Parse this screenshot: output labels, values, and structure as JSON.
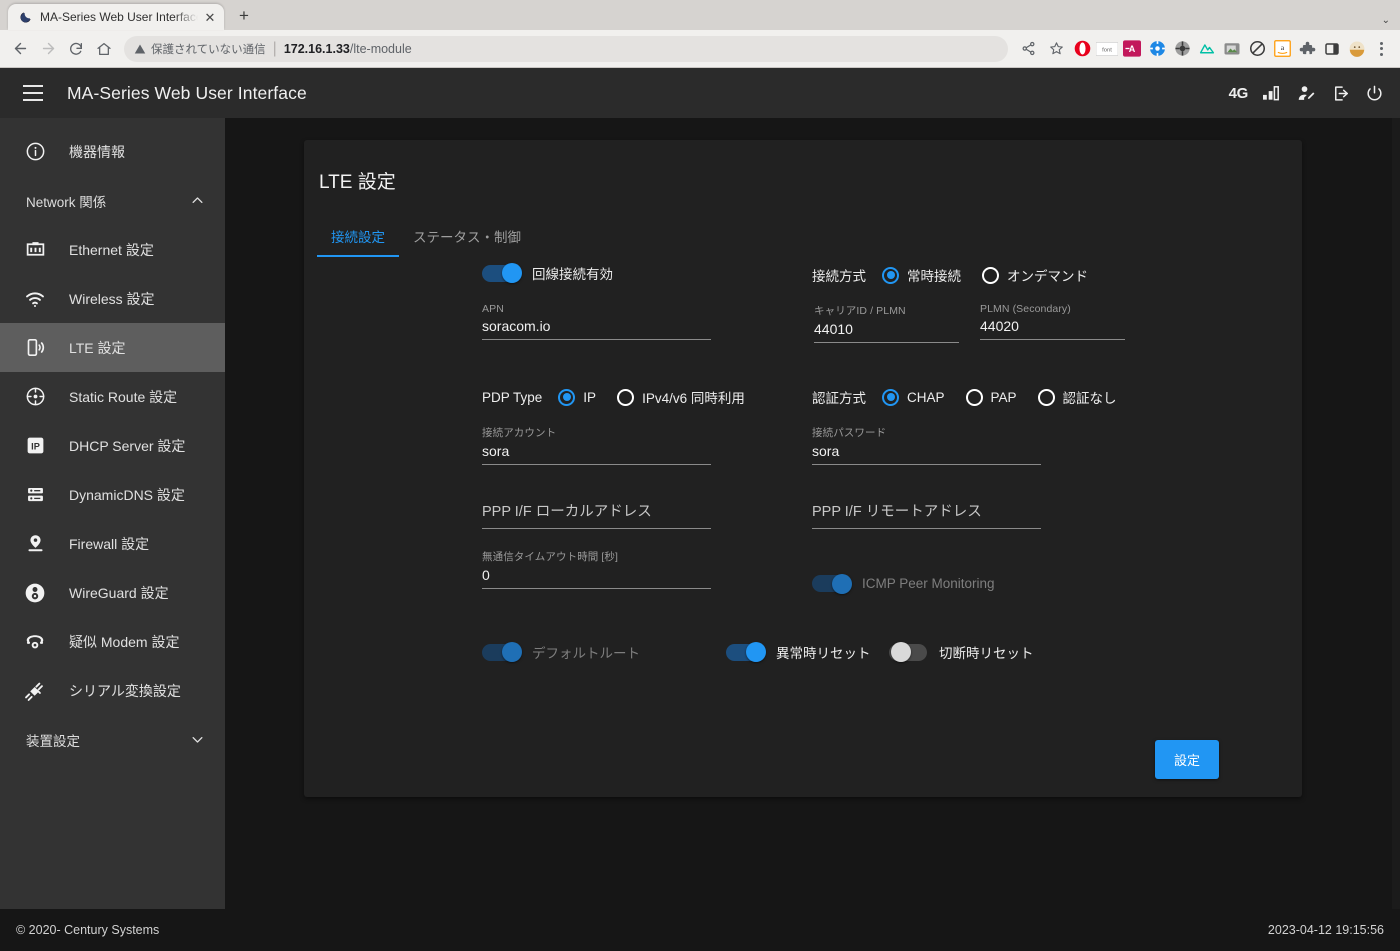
{
  "browser": {
    "tab": {
      "title": "MA-Series Web User Interface",
      "favicon": "moon-icon",
      "close_label": "✕"
    },
    "newtab_label": "+",
    "window_minimize_label": "⌄",
    "nav": {
      "back": "←",
      "forward": "→",
      "reload": "⟳",
      "home": "⌂"
    },
    "omnibox": {
      "security_warning": "保護されていない通信",
      "url_host": "172.16.1.33",
      "url_path": "/lte-module",
      "share_icon": "share-icon",
      "bookmark_icon": "star-icon"
    },
    "extensions": [
      {
        "name": "opera-icon",
        "glyph": "●",
        "color": "#e8001c"
      },
      {
        "name": "font-extension-icon",
        "glyph": "font",
        "color": "#5f6368"
      },
      {
        "name": "translate-extension-icon",
        "glyph": "⇥A",
        "color": "#c2185b"
      },
      {
        "name": "compass-extension-icon",
        "glyph": "✷",
        "color": "#1e88e5"
      },
      {
        "name": "shutter-extension-icon",
        "glyph": "✻",
        "color": "#9e9e9e"
      },
      {
        "name": "mountain-extension-icon",
        "glyph": "▲",
        "color": "#00bfa5"
      },
      {
        "name": "screenshot-extension-icon",
        "glyph": "▣",
        "color": "#8b8b8b"
      },
      {
        "name": "block-extension-icon",
        "glyph": "⊘",
        "color": "#3c3c3c"
      },
      {
        "name": "amazon-extension-icon",
        "glyph": "a",
        "color": "#ff9900"
      },
      {
        "name": "puzzle-extensions-icon",
        "glyph": "✦",
        "color": "#5f6368"
      },
      {
        "name": "sidepanel-icon",
        "glyph": "□",
        "color": "#3c3c3c"
      },
      {
        "name": "profile-avatar-icon",
        "glyph": "◔",
        "color": "#d99a3a"
      }
    ],
    "menu_icon": "kebab-menu-icon"
  },
  "header": {
    "menu_icon": "hamburger-icon",
    "title": "MA-Series Web User Interface",
    "icons": [
      {
        "name": "network-4g-indicator",
        "label": "4G"
      },
      {
        "name": "signal-strength-icon",
        "label": ""
      },
      {
        "name": "user-switch-icon",
        "label": ""
      },
      {
        "name": "logout-icon",
        "label": ""
      },
      {
        "name": "power-icon",
        "label": ""
      }
    ]
  },
  "sidebar": {
    "items": [
      {
        "label": "機器情報",
        "icon": "info-icon",
        "type": "item",
        "active": false
      },
      {
        "label": "Network 関係",
        "icon": "chevron-up-icon",
        "type": "group"
      },
      {
        "label": "Ethernet 設定",
        "icon": "ethernet-icon",
        "type": "item",
        "active": false
      },
      {
        "label": "Wireless 設定",
        "icon": "wifi-icon",
        "type": "item",
        "active": false
      },
      {
        "label": "LTE 設定",
        "icon": "lte-device-icon",
        "type": "item",
        "active": true
      },
      {
        "label": "Static Route 設定",
        "icon": "route-icon",
        "type": "item",
        "active": false
      },
      {
        "label": "DHCP Server 設定",
        "icon": "ip-icon",
        "type": "item",
        "active": false
      },
      {
        "label": "DynamicDNS 設定",
        "icon": "server-icon",
        "type": "item",
        "active": false
      },
      {
        "label": "Firewall 設定",
        "icon": "firewall-icon",
        "type": "item",
        "active": false
      },
      {
        "label": "WireGuard 設定",
        "icon": "wireguard-icon",
        "type": "item",
        "active": false
      },
      {
        "label": "疑似 Modem 設定",
        "icon": "modem-phone-icon",
        "type": "item",
        "active": false
      },
      {
        "label": "シリアル変換設定",
        "icon": "serial-plug-icon",
        "type": "item",
        "active": false
      },
      {
        "label": "装置設定",
        "icon": "chevron-down-icon",
        "type": "group"
      }
    ]
  },
  "page": {
    "title": "LTE 設定",
    "tabs": [
      {
        "label": "接続設定",
        "selected": true
      },
      {
        "label": "ステータス・制御",
        "selected": false
      }
    ],
    "form": {
      "line_enable": {
        "label": "回線接続有効",
        "state": "on",
        "disabled": false
      },
      "connect_mode": {
        "label": "接続方式",
        "options": [
          {
            "label": "常時接続",
            "selected": true
          },
          {
            "label": "オンデマンド",
            "selected": false
          }
        ]
      },
      "apn": {
        "label": "APN",
        "value": "soracom.io"
      },
      "carrier_plmn": {
        "label": "キャリアID / PLMN",
        "value": "44010"
      },
      "plmn_secondary": {
        "label": "PLMN (Secondary)",
        "value": "44020"
      },
      "pdp_type": {
        "label": "PDP Type",
        "options": [
          {
            "label": "IP",
            "selected": true
          },
          {
            "label": "IPv4/v6 同時利用",
            "selected": false
          }
        ]
      },
      "auth_method": {
        "label": "認証方式",
        "options": [
          {
            "label": "CHAP",
            "selected": true
          },
          {
            "label": "PAP",
            "selected": false
          },
          {
            "label": "認証なし",
            "selected": false
          }
        ]
      },
      "account": {
        "label": "接続アカウント",
        "value": "sora"
      },
      "password": {
        "label": "接続パスワード",
        "value": "sora"
      },
      "ppp_local": {
        "label": "",
        "placeholder": "PPP I/F ローカルアドレス",
        "value": ""
      },
      "ppp_remote": {
        "label": "",
        "placeholder": "PPP I/F リモートアドレス",
        "value": ""
      },
      "idle_timeout": {
        "label": "無通信タイムアウト時間 [秒]",
        "value": "0"
      },
      "icmp_monitoring": {
        "label": "ICMP Peer Monitoring",
        "state": "on",
        "disabled": true
      },
      "default_route": {
        "label": "デフォルトルート",
        "state": "on",
        "disabled": true
      },
      "reset_on_error": {
        "label": "異常時リセット",
        "state": "on",
        "disabled": false
      },
      "reset_on_disconnect": {
        "label": "切断時リセット",
        "state": "off",
        "disabled": false
      },
      "submit_label": "設定"
    }
  },
  "footer": {
    "copyright": "© 2020- Century Systems",
    "datetime": "2023-04-12 19:15:56"
  },
  "colors": {
    "accent": "#2196f3",
    "sidebar_bg": "#333333",
    "panel_bg": "#212121",
    "page_bg": "#161616",
    "header_bg": "#2b2b2b"
  }
}
